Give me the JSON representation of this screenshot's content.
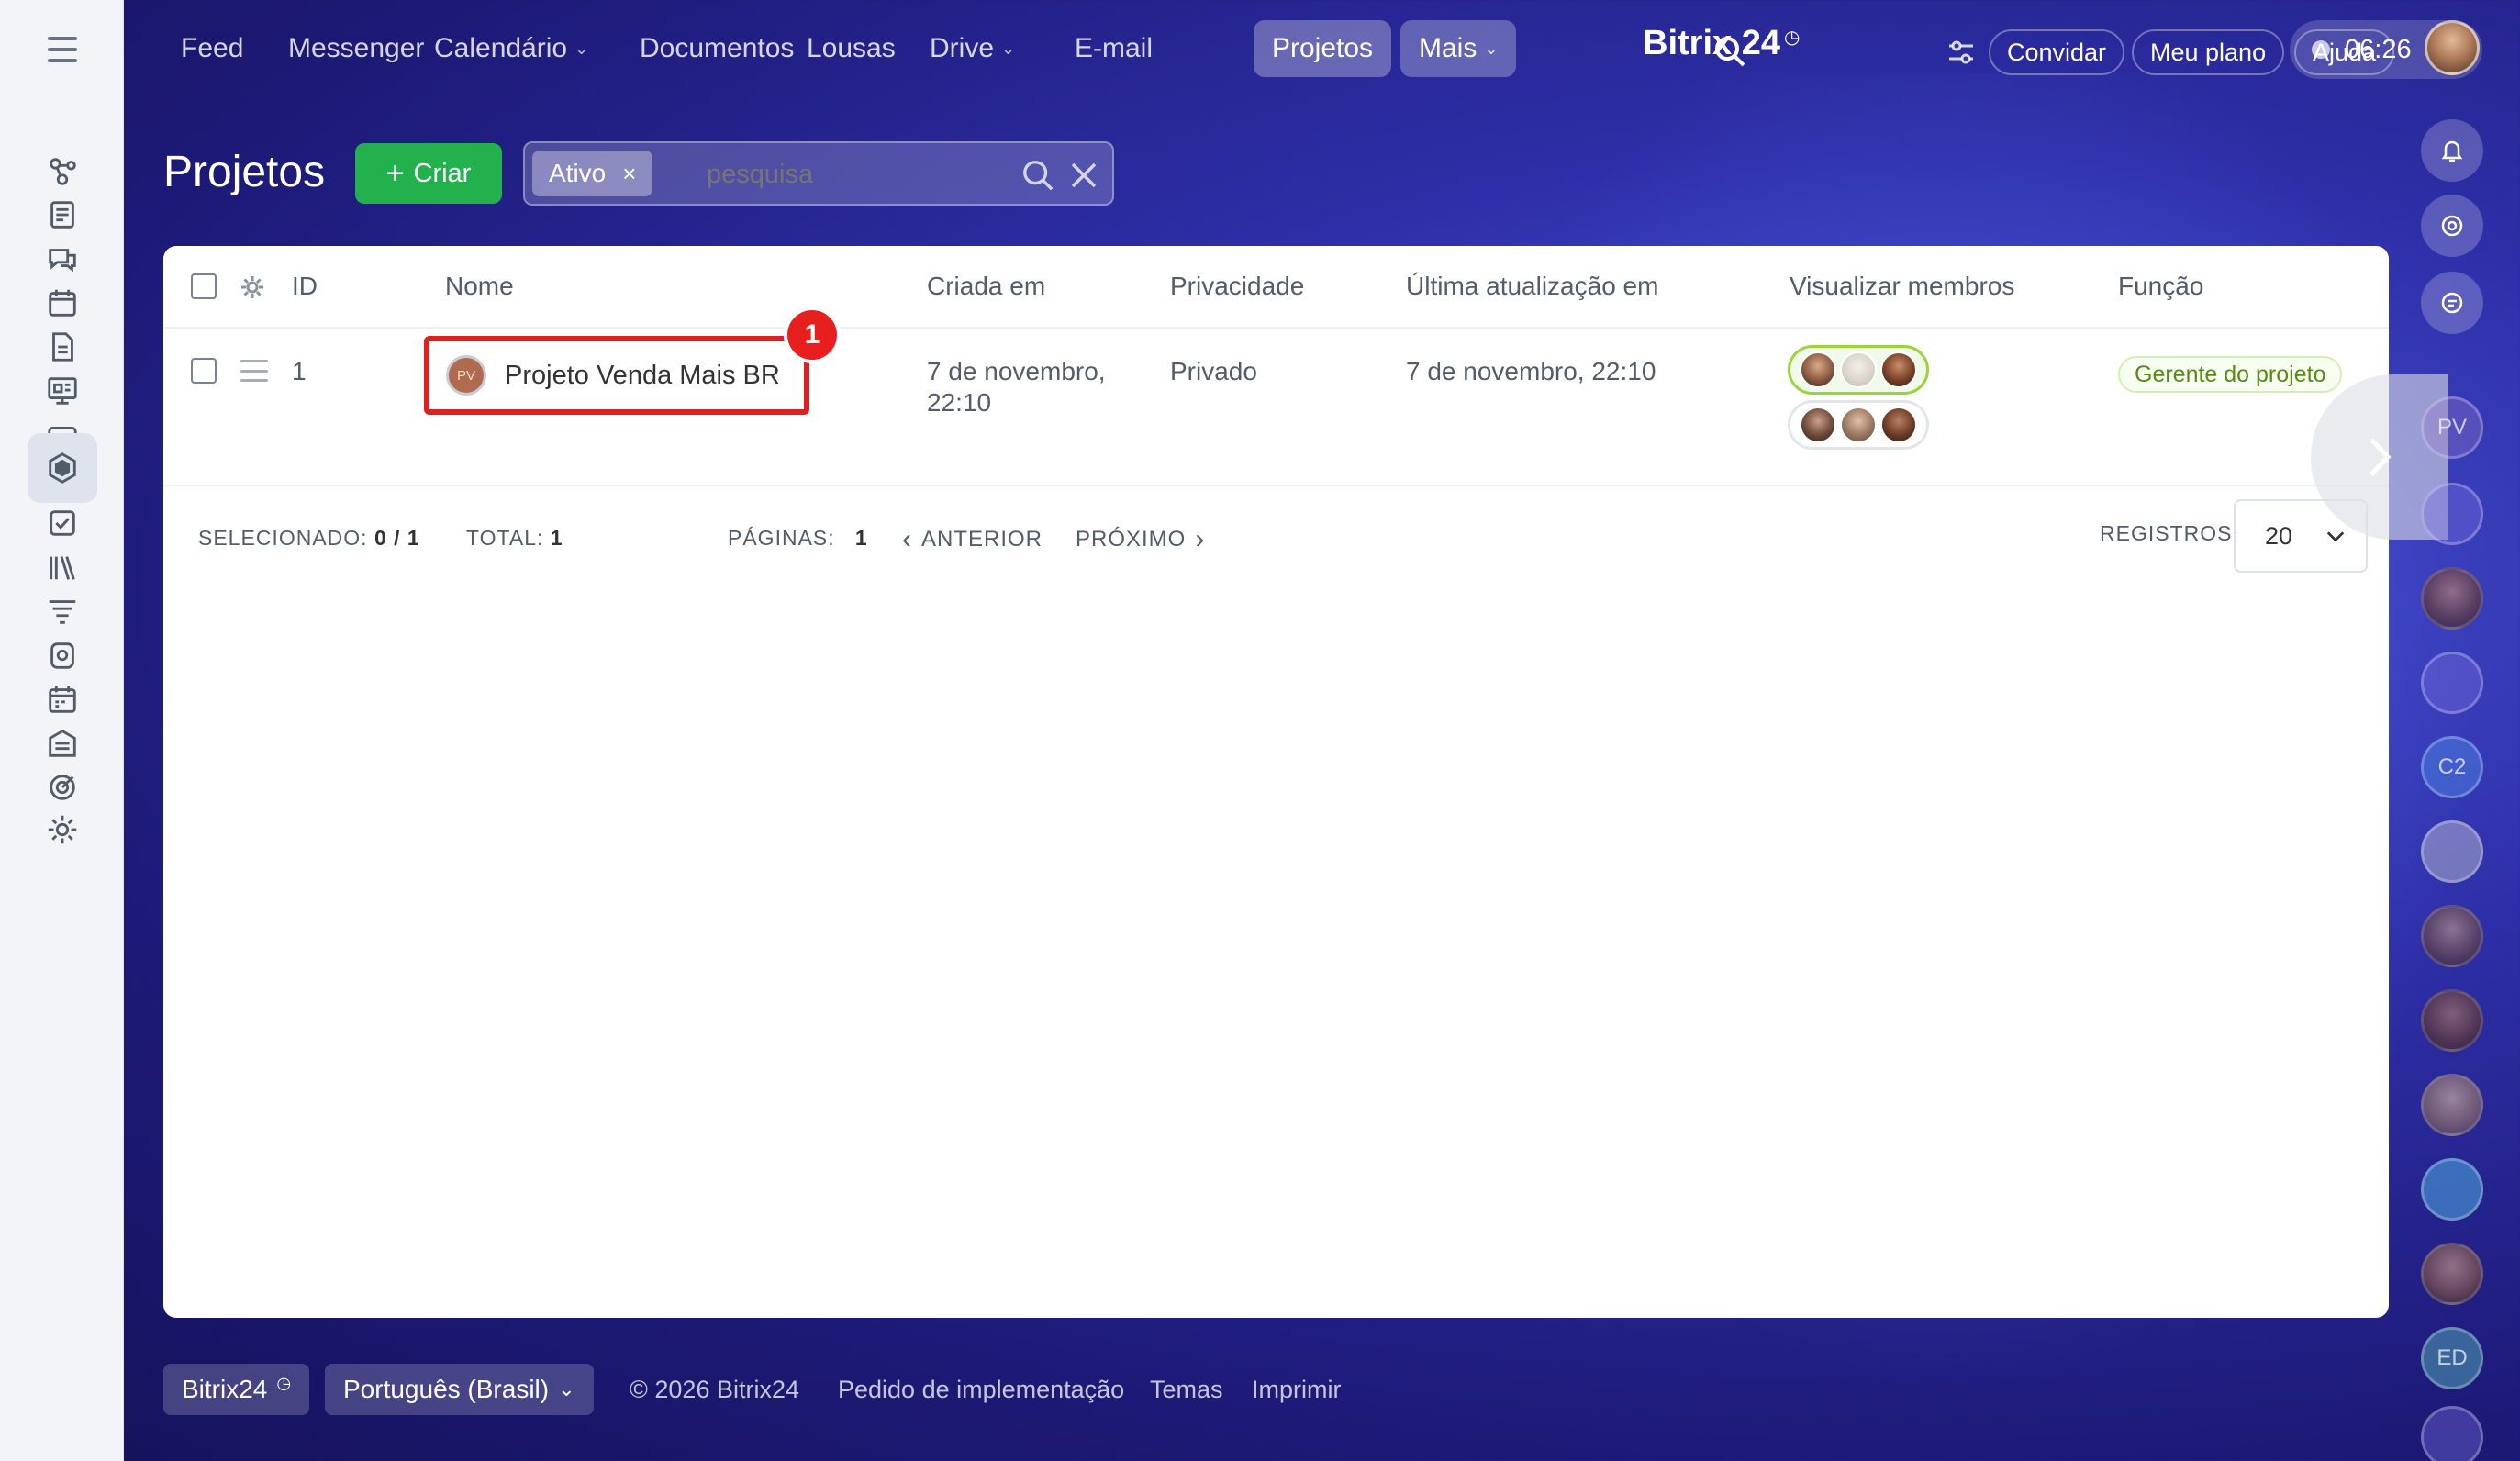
{
  "topnav": {
    "items": [
      {
        "label": "Feed",
        "dropdown": false
      },
      {
        "label": "Messenger",
        "dropdown": false
      },
      {
        "label": "Calendário",
        "dropdown": true
      },
      {
        "label": "Documentos",
        "dropdown": false
      },
      {
        "label": "Lousas",
        "dropdown": false
      },
      {
        "label": "Drive",
        "dropdown": true
      },
      {
        "label": "E-mail",
        "dropdown": false
      },
      {
        "label": "Projetos",
        "dropdown": false,
        "active": true
      },
      {
        "label": "Mais",
        "dropdown": true
      }
    ],
    "logo": "Bitrix 24",
    "invite": "Convidar",
    "plan": "Meu plano",
    "help": "Ajuda",
    "time": "06:26"
  },
  "page": {
    "title": "Projetos",
    "create_label": "Criar",
    "filter_chip": "Ativo",
    "search_placeholder": "pesquisa"
  },
  "table": {
    "columns": [
      "ID",
      "Nome",
      "Criada em",
      "Privacidade",
      "Última atualização em",
      "Visualizar membros",
      "Função"
    ],
    "rows": [
      {
        "id": "1",
        "badge": "PV",
        "name": "Projeto Venda Mais BR",
        "created_line1": "7 de novembro,",
        "created_line2": "22:10",
        "privacy": "Privado",
        "updated": "7 de novembro, 22:10",
        "role": "Gerente do projeto"
      }
    ],
    "step_badge": "1",
    "footer": {
      "selected_label": "SELECIONADO:",
      "selected_value": "0 / 1",
      "total_label": "TOTAL:",
      "total_value": "1",
      "pages_label": "PÁGINAS:",
      "pages_value": "1",
      "prev": "ANTERIOR",
      "next": "PRÓXIMO",
      "records_label": "REGISTROS:",
      "records_value": "20"
    }
  },
  "footer": {
    "brand": "Bitrix24",
    "language": "Português (Brasil)",
    "copyright": "© 2026 Bitrix24",
    "implementation": "Pedido de implementação",
    "themes": "Temas",
    "print": "Imprimir"
  },
  "right_rail": {
    "pv": "PV",
    "c2": "C2",
    "ed": "ED"
  },
  "colors": {
    "accent_green": "#22b14c",
    "highlight_red": "#e02020",
    "role_green": "#5b8a14"
  }
}
